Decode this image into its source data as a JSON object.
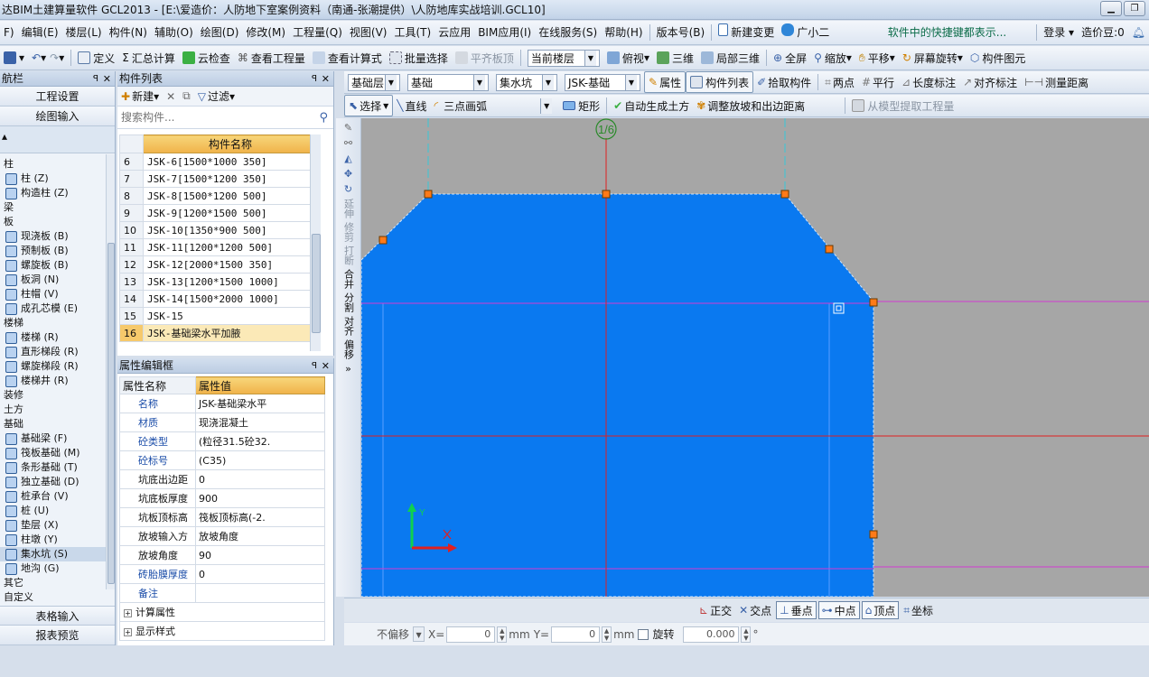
{
  "window": {
    "title": "达BIM土建算量软件 GCL2013 - [E:\\爱造价：人防地下室案例资料（南通-张潮提供）\\人防地库实战培训.GCL10]",
    "minimize": "▁",
    "maximize": "❐"
  },
  "menu": {
    "items": [
      "F) ",
      "编辑(E)",
      "楼层(L)",
      "构件(N)",
      "辅助(O)",
      "绘图(D)",
      "修改(M)",
      "工程量(Q)",
      "视图(V)",
      "工具(T)",
      "云应用",
      "BIM应用(I)",
      "在线服务(S)",
      "帮助(H)",
      "版本号(B)"
    ],
    "new_change": "新建变更",
    "assistant": "广小二",
    "tip": "软件中的快捷键都表示...",
    "login": "登录",
    "cost_beans": "造价豆:0"
  },
  "toolbar1": {
    "define": "定义",
    "summary": "汇总计算",
    "cloud_check": "云检查",
    "view_quantity": "查看工程量",
    "view_formula": "查看计算式",
    "batch_select": "批量选择",
    "flat_top": "平齐板顶",
    "current_floor": "当前楼层",
    "top_view": "俯视",
    "three_d": "三维",
    "local_3d": "局部三维",
    "full_screen": "全屏",
    "zoom": "缩放",
    "pan": "平移",
    "screen_rotate": "屏幕旋转",
    "component_map": "构件图元"
  },
  "leftnav": {
    "title": "航栏",
    "pin": "ꟼ",
    "close": "✕",
    "project_settings": "工程设置",
    "drawing_input": "绘图输入",
    "table_input": "表格输入",
    "report_preview": "报表预览",
    "tree": [
      {
        "label": "柱",
        "type": "group"
      },
      {
        "label": "柱 (Z)",
        "type": "item"
      },
      {
        "label": "构造柱 (Z)",
        "type": "item"
      },
      {
        "label": "梁",
        "type": "group"
      },
      {
        "label": "板",
        "type": "group"
      },
      {
        "label": "现浇板 (B)",
        "type": "item"
      },
      {
        "label": "预制板 (B)",
        "type": "item"
      },
      {
        "label": "螺旋板 (B)",
        "type": "item"
      },
      {
        "label": "板洞 (N)",
        "type": "item"
      },
      {
        "label": "柱帽 (V)",
        "type": "item"
      },
      {
        "label": "成孔芯模 (E)",
        "type": "item"
      },
      {
        "label": "楼梯",
        "type": "group"
      },
      {
        "label": "楼梯 (R)",
        "type": "item"
      },
      {
        "label": "直形梯段 (R)",
        "type": "item"
      },
      {
        "label": "螺旋梯段 (R)",
        "type": "item"
      },
      {
        "label": "楼梯井 (R)",
        "type": "item"
      },
      {
        "label": "装修",
        "type": "group"
      },
      {
        "label": "土方",
        "type": "group"
      },
      {
        "label": "基础",
        "type": "group"
      },
      {
        "label": "基础梁 (F)",
        "type": "item"
      },
      {
        "label": "筏板基础 (M)",
        "type": "item"
      },
      {
        "label": "条形基础 (T)",
        "type": "item"
      },
      {
        "label": "独立基础 (D)",
        "type": "item"
      },
      {
        "label": "桩承台 (V)",
        "type": "item"
      },
      {
        "label": "桩 (U)",
        "type": "item"
      },
      {
        "label": "垫层 (X)",
        "type": "item"
      },
      {
        "label": "柱墩 (Y)",
        "type": "item"
      },
      {
        "label": "集水坑 (S)",
        "type": "item",
        "active": true
      },
      {
        "label": "地沟 (G)",
        "type": "item"
      },
      {
        "label": "其它",
        "type": "group"
      },
      {
        "label": "自定义",
        "type": "group"
      }
    ]
  },
  "complist": {
    "title": "构件列表",
    "new": "新建",
    "filter": "过滤",
    "search_placeholder": "搜索构件...",
    "col_name": "构件名称",
    "rows": [
      {
        "n": "6",
        "name": "JSK-6[1500*1000 350]"
      },
      {
        "n": "7",
        "name": "JSK-7[1500*1200 350]"
      },
      {
        "n": "8",
        "name": "JSK-8[1500*1200 500]"
      },
      {
        "n": "9",
        "name": "JSK-9[1200*1500 500]"
      },
      {
        "n": "10",
        "name": "JSK-10[1350*900 500]"
      },
      {
        "n": "11",
        "name": "JSK-11[1200*1200 500]"
      },
      {
        "n": "12",
        "name": "JSK-12[2000*1500 350]"
      },
      {
        "n": "13",
        "name": "JSK-13[1200*1500 1000]"
      },
      {
        "n": "14",
        "name": "JSK-14[1500*2000 1000]"
      },
      {
        "n": "15",
        "name": "JSK-15"
      },
      {
        "n": "16",
        "name": "JSK-基础梁水平加腋",
        "current": true
      }
    ]
  },
  "props": {
    "title": "属性编辑框",
    "col_name": "属性名称",
    "col_value": "属性值",
    "rows": [
      {
        "name": "名称",
        "value": "JSK-基础梁水平",
        "blue": true
      },
      {
        "name": "材质",
        "value": "现浇混凝土",
        "blue": true
      },
      {
        "name": "砼类型",
        "value": "(粒径31.5砼32.",
        "blue": true
      },
      {
        "name": "砼标号",
        "value": "(C35)",
        "blue": true
      },
      {
        "name": "坑底出边距",
        "value": "0"
      },
      {
        "name": "坑底板厚度",
        "value": "900"
      },
      {
        "name": "坑板顶标高",
        "value": "筏板顶标高(-2."
      },
      {
        "name": "放坡输入方",
        "value": "放坡角度"
      },
      {
        "name": "放坡角度",
        "value": "90"
      },
      {
        "name": "砖胎膜厚度",
        "value": "0",
        "blue": true
      },
      {
        "name": "备注",
        "value": "",
        "blue": true
      }
    ],
    "calc_props": "计算属性",
    "display_style": "显示样式"
  },
  "tb2": {
    "layer_type": "基础层",
    "category": "基础",
    "component_type": "集水坑",
    "component": "JSK-基础",
    "property": "属性",
    "component_list": "构件列表",
    "pick": "拾取构件",
    "two_points": "两点",
    "parallel": "平行",
    "length_mark": "长度标注",
    "align_mark": "对齐标注",
    "measure": "测量距离"
  },
  "tb3": {
    "select": "选择",
    "line": "直线",
    "arc3": "三点画弧",
    "rect": "矩形",
    "auto_earth": "自动生成土方",
    "adjust_slope": "调整放坡和出边距离",
    "extract": "从模型提取工程量"
  },
  "vtool": {
    "extend": "延伸",
    "trim": "修剪",
    "break": "打断",
    "merge": "合并",
    "split": "分割",
    "align": "对齐",
    "offset": "偏移"
  },
  "canvas": {
    "axis_label": "1/6",
    "y_label": "Y",
    "fill_color": "#0a79f0",
    "bg_color": "#a6a6a6"
  },
  "snap": {
    "ortho": "正交",
    "intersect": "交点",
    "perp": "垂点",
    "mid": "中点",
    "vertex": "顶点",
    "coord": "坐标"
  },
  "coord": {
    "no_offset": "不偏移",
    "x_label": "X=",
    "x_val": "0",
    "y_label": "Y=",
    "y_val": "0",
    "mm": "mm",
    "rotate": "旋转",
    "rotate_val": "0.000",
    "deg": "°"
  }
}
